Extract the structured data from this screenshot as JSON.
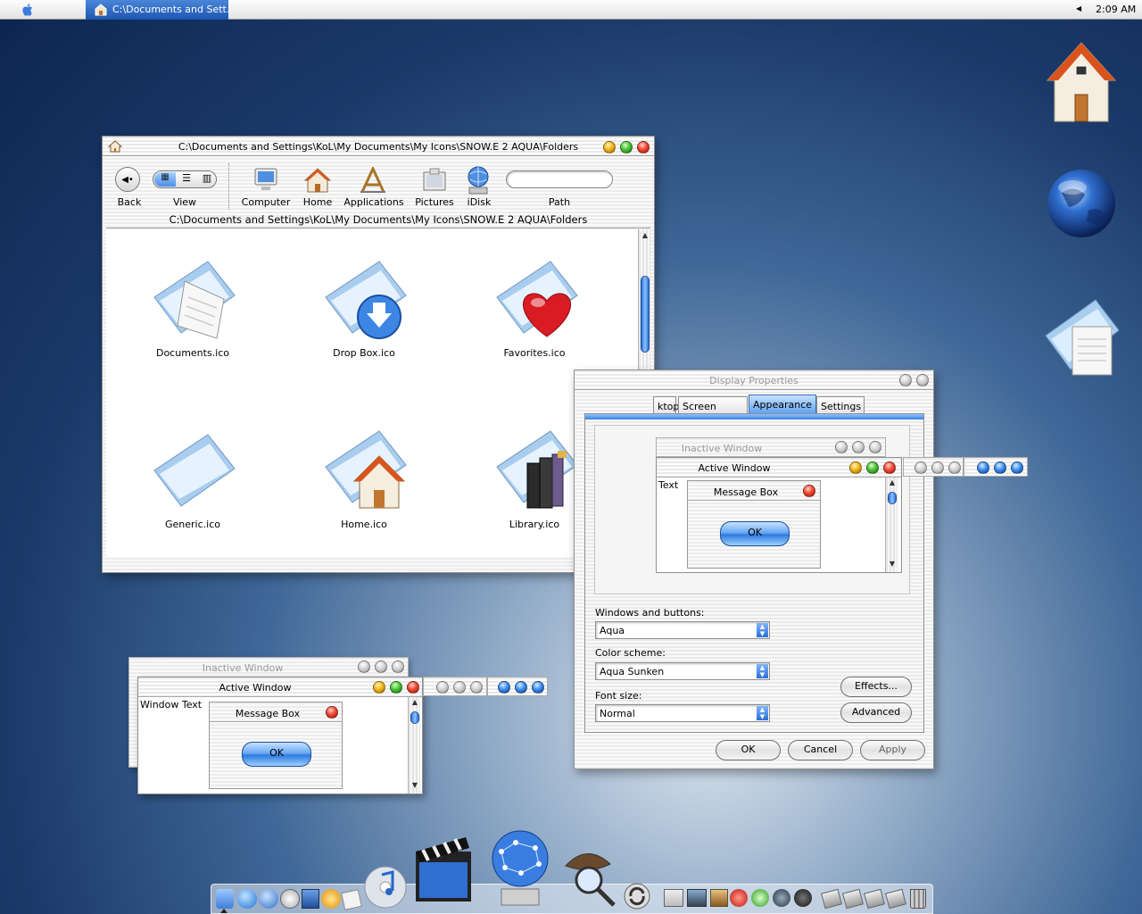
{
  "menubar": {
    "taskbar_window_title": "C:\\Documents and Sett...",
    "clock": "2:09 AM"
  },
  "explorer": {
    "title": "C:\\Documents and Settings\\KoL\\My Documents\\My Icons\\SNOW.E 2 AQUA\\Folders",
    "toolbar": {
      "back": "Back",
      "view": "View",
      "computer": "Computer",
      "home": "Home",
      "applications": "Applications",
      "pictures": "Pictures",
      "idisk": "iDisk",
      "path": "Path"
    },
    "path_bar": "C:\\Documents and Settings\\KoL\\My Documents\\My Icons\\SNOW.E 2 AQUA\\Folders",
    "files": [
      {
        "name": "Documents.ico",
        "icon": "folder-documents-icon"
      },
      {
        "name": "Drop Box.ico",
        "icon": "folder-dropbox-icon"
      },
      {
        "name": "Favorites.ico",
        "icon": "folder-favorites-icon"
      },
      {
        "name": "Generic.ico",
        "icon": "folder-generic-icon"
      },
      {
        "name": "Home.ico",
        "icon": "folder-home-icon"
      },
      {
        "name": "Library.ico",
        "icon": "folder-library-icon"
      }
    ]
  },
  "display_properties": {
    "title": "Display Properties",
    "tabs": [
      "ktop",
      "Screen Saver",
      "Appearance",
      "Settings"
    ],
    "active_tab": "Appearance",
    "preview": {
      "inactive_window": "Inactive Window",
      "active_window": "Active Window",
      "window_text": "Text",
      "message_box": "Message Box",
      "ok": "OK"
    },
    "windows_and_buttons_label": "Windows and buttons:",
    "windows_and_buttons_value": "Aqua",
    "color_scheme_label": "Color scheme:",
    "color_scheme_value": "Aqua Sunken",
    "font_size_label": "Font size:",
    "font_size_value": "Normal",
    "effects": "Effects...",
    "advanced": "Advanced",
    "ok": "OK",
    "cancel": "Cancel",
    "apply": "Apply"
  },
  "preview_widget": {
    "inactive_window": "Inactive Window",
    "active_window": "Active Window",
    "window_text": "Window Text",
    "message_box": "Message Box",
    "ok": "OK"
  },
  "colors": {
    "accent_blue": "#2e7ce0",
    "close_red": "#f14a34",
    "minimize_yellow": "#f2b51e",
    "zoom_green": "#4cc23a"
  }
}
